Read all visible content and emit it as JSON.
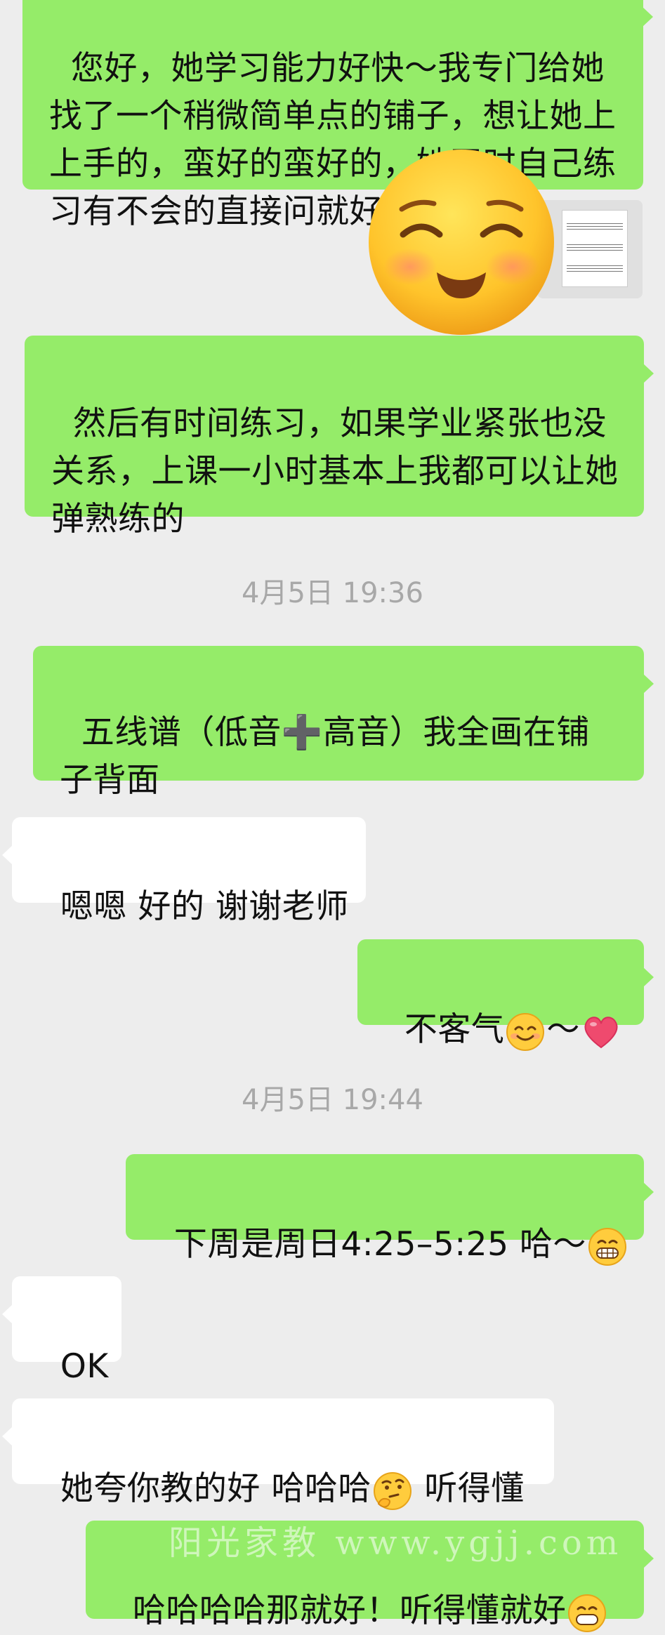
{
  "messages": [
    {
      "text": "您好，她学习能力好快～我专门给她找了一个稍微简单点的铺子，想让她上上手的，蛮好的蛮好的，她平时自己练习有不会的直接问就好啦～"
    },
    {
      "text": "然后有时间练习，如果学业紧张也没关系，上课一小时基本上我都可以让她弹熟练的"
    },
    {
      "text": "五线谱（低音➕高音）我全画在铺子背面"
    },
    {
      "text": "嗯嗯 好的 谢谢老师"
    },
    {
      "text": "不客气"
    },
    {
      "text": "下周是周日4:25–5:25 哈～"
    },
    {
      "text": "OK"
    },
    {
      "text_before": "她夸你教的好 哈哈哈",
      "text_after": " 听得懂"
    },
    {
      "text": "哈哈哈哈那就好！听得懂就好"
    }
  ],
  "timestamps": [
    "4月5日 19:36",
    "4月5日 19:44"
  ],
  "tilde": "～",
  "watermark": "阳光家教 www.ygjj.com",
  "icons": {
    "big_emoji": "smiling-face-with-smiling-eyes-icon",
    "smile": "smile-icon",
    "heart": "heart-icon",
    "grin": "grinning-face-icon",
    "thinking": "thinking-face-icon",
    "sheet": "sheet-music-thumbnail"
  },
  "colors": {
    "outgoing": "#95ec69",
    "incoming": "#ffffff",
    "background": "#ededed",
    "timestamp": "#a8a8a8"
  }
}
